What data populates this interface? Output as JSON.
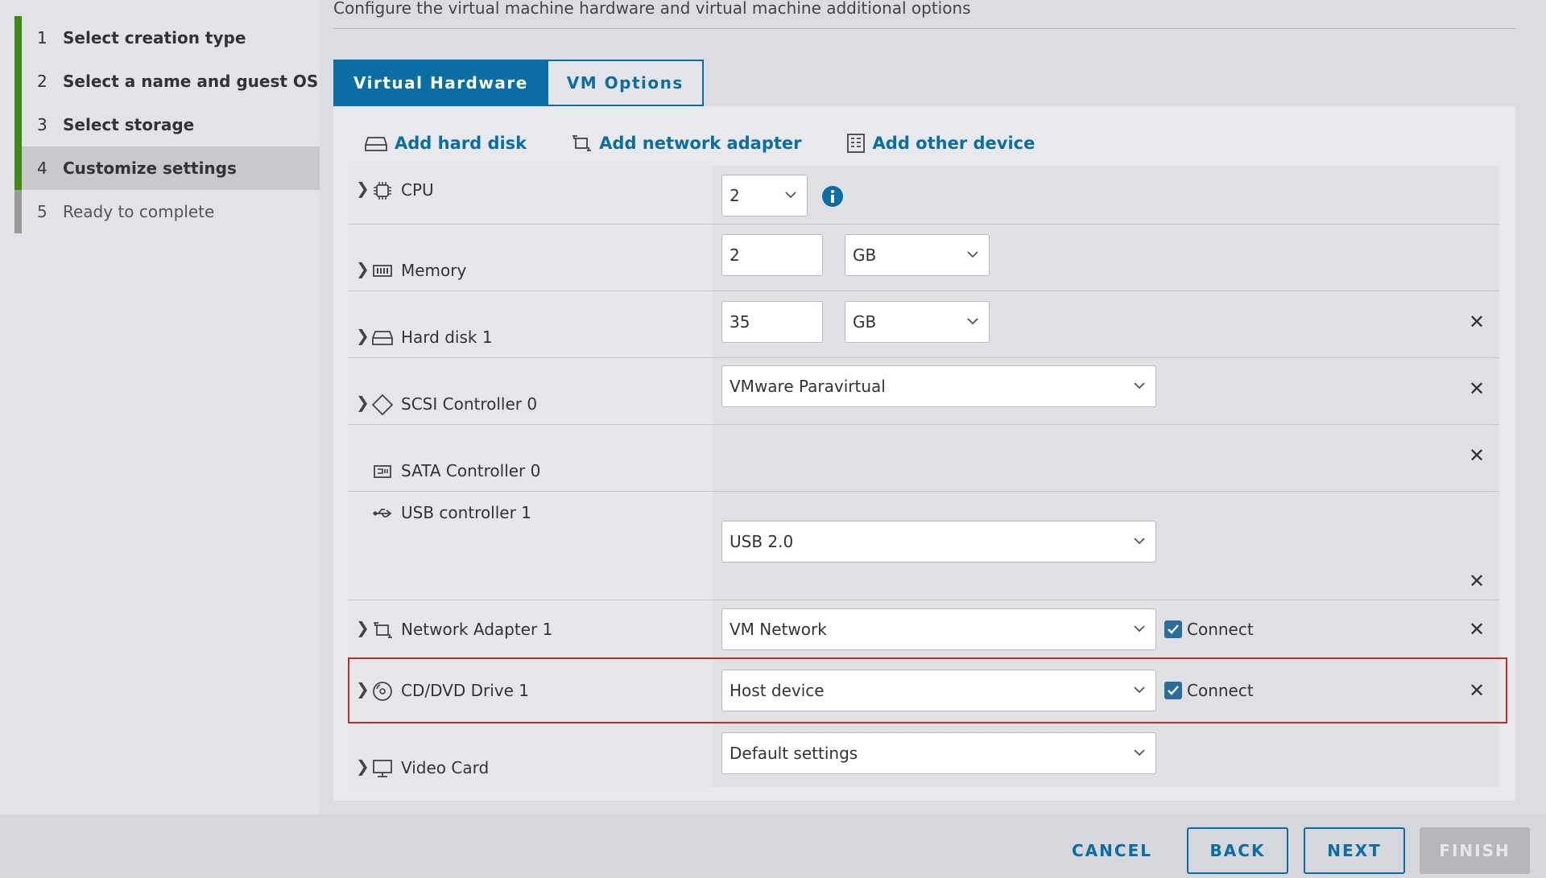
{
  "wizard": {
    "steps": [
      {
        "num": "1",
        "label": "Select creation type"
      },
      {
        "num": "2",
        "label": "Select a name and guest OS"
      },
      {
        "num": "3",
        "label": "Select storage"
      },
      {
        "num": "4",
        "label": "Customize settings"
      },
      {
        "num": "5",
        "label": "Ready to complete"
      }
    ],
    "current_step": "4"
  },
  "main": {
    "subtitle": "Configure the virtual machine hardware and virtual machine additional options",
    "tabs": [
      {
        "label": "Virtual Hardware",
        "active": true
      },
      {
        "label": "VM Options",
        "active": false
      }
    ],
    "actions": [
      {
        "label": "Add hard disk",
        "icon": "hard-disk-icon"
      },
      {
        "label": "Add network adapter",
        "icon": "network-adapter-icon"
      },
      {
        "label": "Add other device",
        "icon": "other-device-icon"
      }
    ]
  },
  "hardware": {
    "cpu": {
      "label": "CPU",
      "value": "2",
      "icon": "cpu-icon",
      "info_icon": "info-icon"
    },
    "memory": {
      "label": "Memory",
      "value": "2",
      "unit": "GB",
      "icon": "memory-icon"
    },
    "hard_disk": {
      "label": "Hard disk 1",
      "value": "35",
      "unit": "GB",
      "icon": "hard-disk-icon"
    },
    "scsi": {
      "label": "SCSI Controller 0",
      "value": "VMware Paravirtual",
      "icon": "scsi-controller-icon"
    },
    "sata": {
      "label": "SATA Controller 0",
      "icon": "sata-controller-icon"
    },
    "usb": {
      "label": "USB controller 1",
      "value": "USB 2.0",
      "icon": "usb-icon"
    },
    "network": {
      "label": "Network Adapter 1",
      "value": "VM Network",
      "connect_label": "Connect",
      "connected": true,
      "icon": "network-adapter-icon"
    },
    "cdrom": {
      "label": "CD/DVD Drive 1",
      "value": "Host device",
      "connect_label": "Connect",
      "connected": true,
      "icon": "cd-dvd-icon",
      "highlighted": true
    },
    "video": {
      "label": "Video Card",
      "value": "Default settings",
      "icon": "monitor-icon"
    }
  },
  "footer": {
    "cancel": "CANCEL",
    "back": "BACK",
    "next": "NEXT",
    "finish": "FINISH"
  },
  "colors": {
    "accent": "#0a6ea5",
    "step_done": "#3e8a13",
    "highlight": "#c32b25"
  }
}
